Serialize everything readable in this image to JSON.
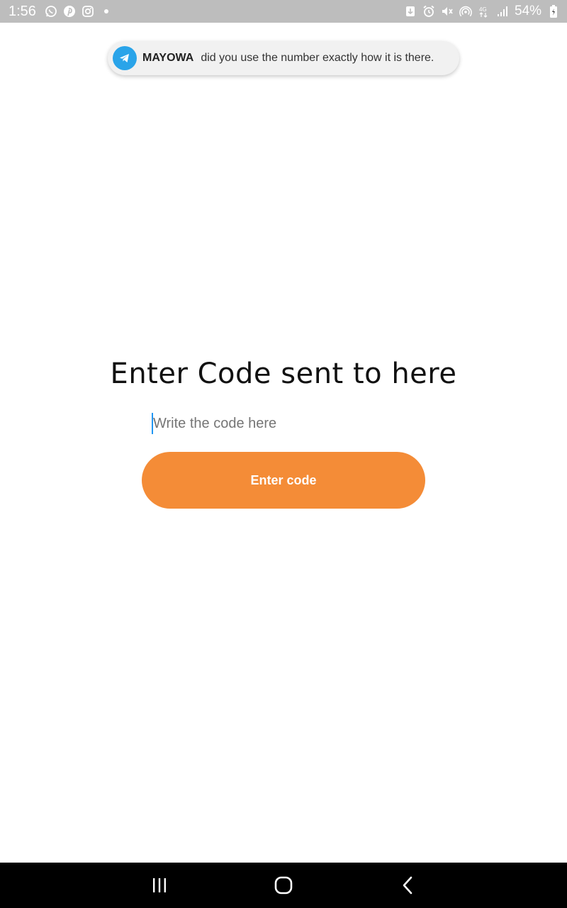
{
  "status_bar": {
    "time": "1:56",
    "battery": "54%",
    "left_icons": [
      "whatsapp-icon",
      "pinterest-icon",
      "instagram-icon"
    ],
    "right_icons": [
      "download-icon",
      "alarm-icon",
      "mute-icon",
      "hotspot-icon",
      "network-4g-icon",
      "signal-icon",
      "battery-icon"
    ]
  },
  "notification": {
    "app_icon": "telegram-icon",
    "sender": "MAYOWA",
    "message": "did you use the number exactly how it is there."
  },
  "main": {
    "title": "Enter Code sent to  here",
    "code_input": {
      "placeholder": "Write the code here",
      "value": ""
    },
    "enter_button_label": "Enter code"
  },
  "nav_bar": {
    "buttons": [
      "recents-icon",
      "home-icon",
      "back-icon"
    ]
  },
  "colors": {
    "status_bar": "#bdbdbd",
    "accent": "#f48c37",
    "telegram": "#2aa4e9",
    "caret": "#2196f3"
  }
}
